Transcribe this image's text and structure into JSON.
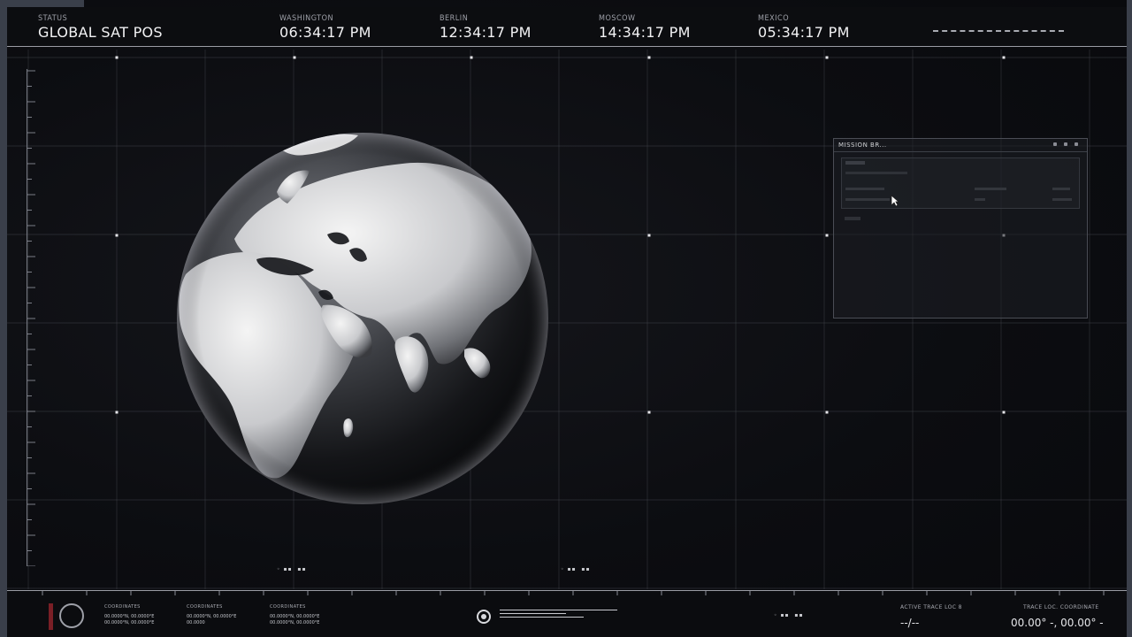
{
  "header": {
    "status_label": "STATUS",
    "status_value": "GLOBAL SAT POS",
    "clocks": [
      {
        "city": "WASHINGTON",
        "time": "06:34:17 PM"
      },
      {
        "city": "BERLIN",
        "time": "12:34:17 PM"
      },
      {
        "city": "MOSCOW",
        "time": "14:34:17 PM"
      },
      {
        "city": "MEXICO",
        "time": "05:34:17 PM"
      }
    ]
  },
  "mission_window": {
    "title": "MISSION BR..."
  },
  "footer": {
    "coordinates": [
      {
        "label": "COORDINATES",
        "lines": [
          "00.0000°N, 00.0000°E",
          "00.0000°N, 00.0000°E"
        ]
      },
      {
        "label": "COORDINATES",
        "lines": [
          "00.0000°N, 00.0000°E",
          "00.0000"
        ]
      },
      {
        "label": "COORDINATES",
        "lines": [
          "00.0000°N, 00.0000°E",
          "00.0000°N, 00.0000°E"
        ]
      }
    ],
    "active_trace_label": "ACTIVE TRACE LOC 8",
    "active_trace_value": "--/--",
    "trace_loc_label": "TRACE LOC. COORDINATE",
    "trace_loc_value": "00.00° -, 00.00° -"
  },
  "colors": {
    "background": "#0b0c10",
    "grid": "#4a4c54",
    "accent_red": "#7a1f26",
    "frame": "#3a3f4a"
  },
  "icons": {
    "status_ring": "ring-icon",
    "target": "target-icon",
    "cursor": "cursor-icon"
  }
}
